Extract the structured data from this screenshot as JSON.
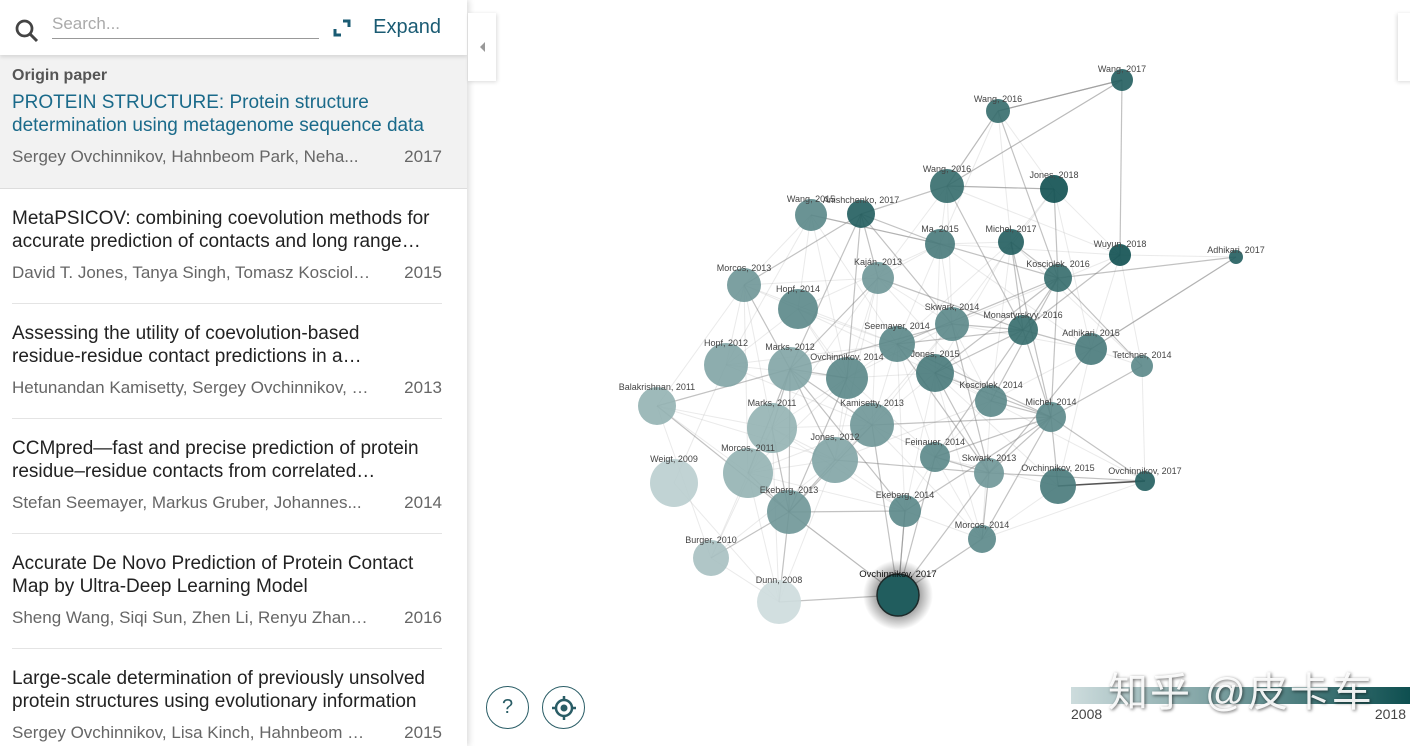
{
  "search": {
    "placeholder": "Search...",
    "expand_label": "Expand"
  },
  "origin": {
    "label": "Origin paper",
    "title": "PROTEIN STRUCTURE: Protein structure determination using metagenome sequence data",
    "authors": "Sergey Ovchinnikov, Hahnbeom Park, Neha...",
    "year": "2017"
  },
  "papers": [
    {
      "title": "MetaPSICOV: combining coevolution methods for accurate prediction of contacts and long range hydrogen bonding",
      "authors": "David T. Jones, Tanya Singh, Tomasz Kosciolek,...",
      "year": "2015"
    },
    {
      "title": "Assessing the utility of coevolution-based residue-residue contact predictions in a sequence- and structure-rich era",
      "authors": "Hetunandan Kamisetty, Sergey Ovchinnikov, David Baker",
      "year": "2013"
    },
    {
      "title": "CCMpred—fast and precise prediction of protein residue–residue contacts from correlated mutations",
      "authors": "Stefan Seemayer, Markus Gruber, Johannes...",
      "year": "2014"
    },
    {
      "title": "Accurate De Novo Prediction of Protein Contact Map by Ultra-Deep Learning Model",
      "authors": "Sheng Wang, Siqi Sun, Zhen Li, Renyu Zhang,...",
      "year": "2016"
    },
    {
      "title": "Large-scale determination of previously unsolved protein structures using evolutionary information",
      "authors": "Sergey Ovchinnikov, Lisa Kinch, Hahnbeom Park,...",
      "year": "2015"
    }
  ],
  "graph": {
    "origin_node": "Ovchinnikov, 2017",
    "nodes": [
      {
        "label": "Wang, 2017",
        "year": 2017
      },
      {
        "label": "Wang, 2016",
        "year": 2016
      },
      {
        "label": "Wang, 2016",
        "year": 2016
      },
      {
        "label": "Jones, 2018",
        "year": 2018
      },
      {
        "label": "Wang, 2015",
        "year": 2014
      },
      {
        "label": "Anishchenko, 2017",
        "year": 2017
      },
      {
        "label": "Ma, 2015",
        "year": 2015
      },
      {
        "label": "Michel, 2017",
        "year": 2017
      },
      {
        "label": "Wuyun, 2018",
        "year": 2018
      },
      {
        "label": "Adhikari, 2017",
        "year": 2017
      },
      {
        "label": "Kosciolek, 2016",
        "year": 2016
      },
      {
        "label": "Kaján, 2013",
        "year": 2013
      },
      {
        "label": "Morcos, 2013",
        "year": 2013
      },
      {
        "label": "Hopf, 2014",
        "year": 2014
      },
      {
        "label": "Skwark, 2014",
        "year": 2014
      },
      {
        "label": "Monastyrskyy, 2016",
        "year": 2016
      },
      {
        "label": "Seemayer, 2014",
        "year": 2014
      },
      {
        "label": "Adhikari, 2015",
        "year": 2015
      },
      {
        "label": "Tetchner, 2014",
        "year": 2014
      },
      {
        "label": "Hopf, 2012",
        "year": 2012
      },
      {
        "label": "Marks, 2012",
        "year": 2012
      },
      {
        "label": "Ovchinnikov, 2014",
        "year": 2014
      },
      {
        "label": "Jones, 2015",
        "year": 2015
      },
      {
        "label": "Balakrishnan, 2011",
        "year": 2011
      },
      {
        "label": "Kosciolek, 2014",
        "year": 2014
      },
      {
        "label": "Michel, 2014",
        "year": 2014
      },
      {
        "label": "Marks, 2011",
        "year": 2011
      },
      {
        "label": "Kamisetty, 2013",
        "year": 2013
      },
      {
        "label": "Feinauer, 2014",
        "year": 2014
      },
      {
        "label": "Jones, 2012",
        "year": 2012
      },
      {
        "label": "Skwark, 2013",
        "year": 2013
      },
      {
        "label": "Weigt, 2009",
        "year": 2009
      },
      {
        "label": "Morcos, 2011",
        "year": 2011
      },
      {
        "label": "Ovchinnikov, 2015",
        "year": 2015
      },
      {
        "label": "Ovchinnikov, 2017",
        "year": 2017
      },
      {
        "label": "Ekeberg, 2013",
        "year": 2013
      },
      {
        "label": "Ekeberg, 2014",
        "year": 2014
      },
      {
        "label": "Morcos, 2014",
        "year": 2014
      },
      {
        "label": "Burger, 2010",
        "year": 2010
      },
      {
        "label": "Dunn, 2008",
        "year": 2008
      },
      {
        "label": "Ovchinnikov, 2017",
        "year": 2017
      }
    ]
  },
  "controls": {
    "help_label": "?",
    "recenter_icon": "crosshair-icon"
  },
  "legend": {
    "min_year": "2008",
    "max_year": "2018",
    "color_light": "#cddcdd",
    "color_dark": "#0e4f50"
  },
  "watermark": "知乎 @皮卡车"
}
